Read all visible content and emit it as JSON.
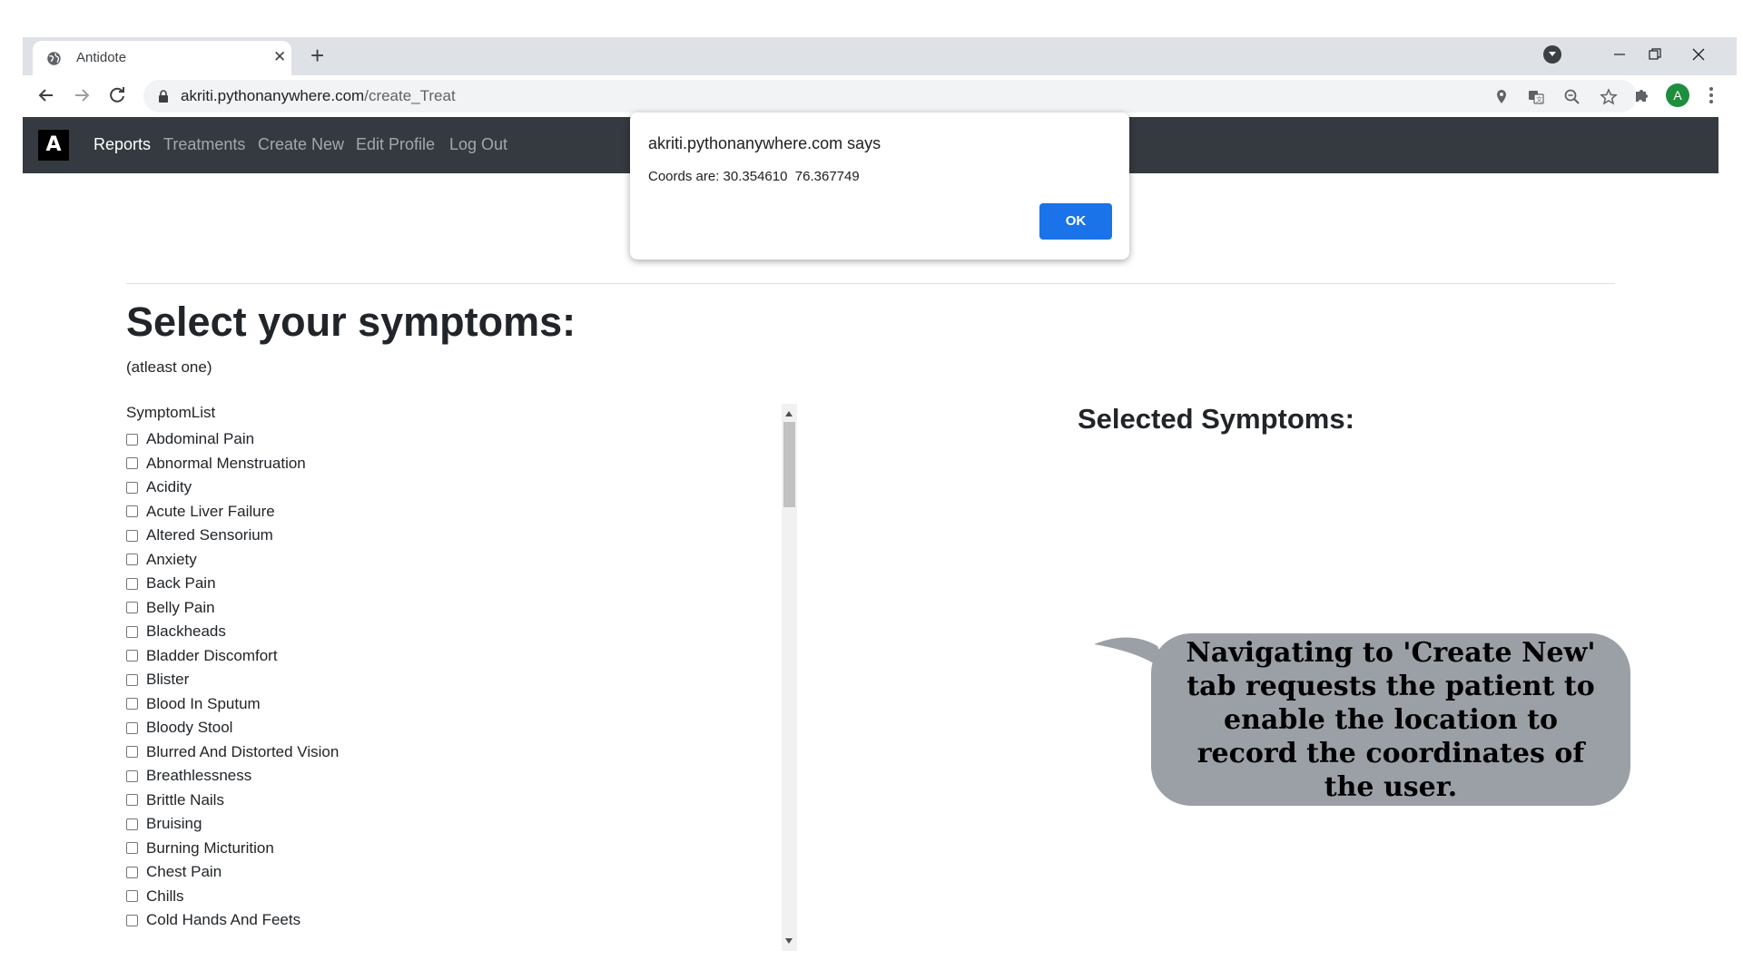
{
  "browser": {
    "tab_title": "Antidote",
    "tab_icon": "globe-icon",
    "url_host": "akriti.pythonanywhere.com",
    "url_path": "/create_Treat",
    "profile_initial": "A"
  },
  "navbar": {
    "brand": "A",
    "links": [
      "Reports",
      "Treatments",
      "Create New",
      "Edit Profile",
      "Log Out"
    ],
    "active": "Reports"
  },
  "main": {
    "title": "Select your symptoms:",
    "subtitle": "(atleast one)",
    "list_header": "SymptomList",
    "symptoms": [
      "Abdominal Pain",
      "Abnormal Menstruation",
      "Acidity",
      "Acute Liver Failure",
      "Altered Sensorium",
      "Anxiety",
      "Back Pain",
      "Belly Pain",
      "Blackheads",
      "Bladder Discomfort",
      "Blister",
      "Blood In Sputum",
      "Bloody Stool",
      "Blurred And Distorted Vision",
      "Breathlessness",
      "Brittle Nails",
      "Bruising",
      "Burning Micturition",
      "Chest Pain",
      "Chills",
      "Cold Hands And Feets"
    ],
    "selected_title": "Selected Symptoms:"
  },
  "dialog": {
    "title": "akriti.pythonanywhere.com says",
    "message": "Coords are: 30.354610  76.367749",
    "ok_label": "OK"
  },
  "annotation": {
    "text": "Navigating to 'Create New' tab requests the patient to enable the location to record the coordinates of the user."
  },
  "colors": {
    "navbar_bg": "#343a40",
    "ok_button": "#1a73e8",
    "bubble": "#9aa0a6"
  }
}
